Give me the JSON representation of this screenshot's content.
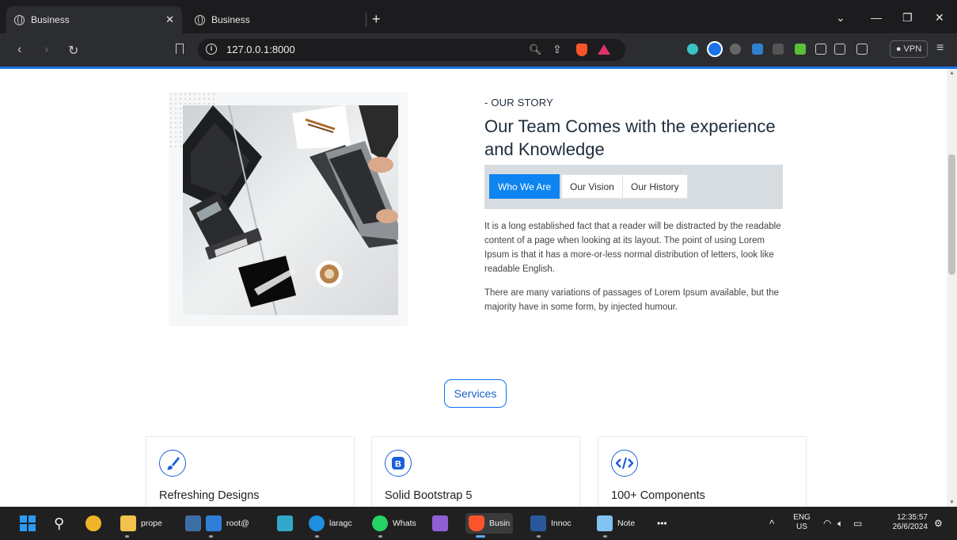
{
  "browser": {
    "tabs": [
      {
        "label": "Business",
        "active": true
      },
      {
        "label": "Business",
        "active": false
      }
    ],
    "address": "127.0.0.1:8000",
    "vpn_label": "VPN"
  },
  "about": {
    "label": "- OUR STORY",
    "headline": "Our Team Comes with the experience and Knowledge",
    "tabs": [
      "Who We Are",
      "Our Vision",
      "Our History"
    ],
    "paragraph1": "It is a long established fact that a reader will be distracted by the readable content of a page when looking at its layout. The point of using Lorem Ipsum is that it has a more-or-less normal distribution of letters, look like readable English.",
    "paragraph2": "There are many variations of passages of Lorem Ipsum available, but the majority have in some form, by injected humour."
  },
  "services": {
    "label": "Services",
    "cards": [
      {
        "title": "Refreshing Designs",
        "icon": "paintbrush-icon"
      },
      {
        "title": "Solid Bootstrap 5",
        "icon": "bootstrap-icon"
      },
      {
        "title": "100+ Components",
        "icon": "code-icon"
      }
    ]
  },
  "taskbar": {
    "apps": [
      "prope",
      "root@",
      "laragc",
      "Whats",
      "Busin",
      "Innoc",
      "Note"
    ],
    "overflow": "•••",
    "language": [
      "ENG",
      "US"
    ],
    "time": "12:35:57",
    "date": "26/6/2024"
  },
  "colors": {
    "accent": "#0d84f0",
    "brand_blue": "#1d5fd8",
    "tabs_bar": "#d7dce1"
  }
}
